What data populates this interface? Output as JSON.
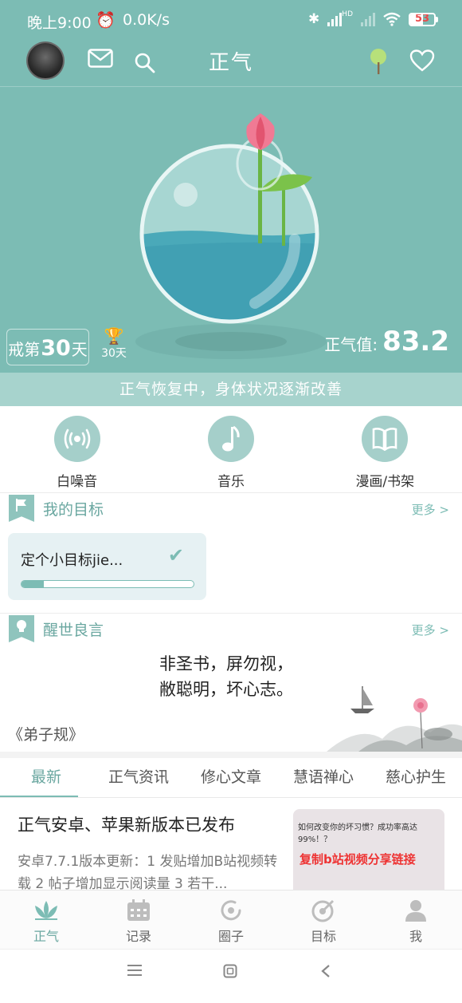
{
  "status": {
    "time": "晚上9:00",
    "speed": "0.0K/s",
    "network": "HD",
    "battery": "53"
  },
  "header": {
    "title": "正气"
  },
  "hero": {
    "streak_prefix": "戒第",
    "streak_days": "30",
    "streak_suffix": "天",
    "trophy_label": "30天",
    "value_label": "正气值:",
    "value": "83.2"
  },
  "banner": "正气恢复中，身体状况逐渐改善",
  "quick_actions": [
    {
      "label": "白噪音",
      "icon": "radio-waves-icon"
    },
    {
      "label": "音乐",
      "icon": "music-note-icon"
    },
    {
      "label": "漫画/书架",
      "icon": "book-icon"
    }
  ],
  "goals": {
    "title": "我的目标",
    "more": "更多 >",
    "card": {
      "name": "定个小目标jie...",
      "progress": 0.13
    }
  },
  "quote": {
    "title": "醒世良言",
    "more": "更多 >",
    "line1": "非圣书，屏勿视，",
    "line2": "敝聪明，坏心志。",
    "source": "《弟子规》"
  },
  "tabs": [
    "最新",
    "正气资讯",
    "修心文章",
    "慧语禅心",
    "慈心护生"
  ],
  "news": {
    "title": "正气安卓、苹果新版本已发布",
    "summary": "安卓7.7.1版本更新：1 发贴增加B站视频转载 2 帖子增加显示阅读量 3 若干...",
    "thumb_text1": "如何改变你的坏习惯？成功率高达99%！？",
    "thumb_text2": "复制b站视频分享链接"
  },
  "tabbar": [
    {
      "label": "正气",
      "icon": "lotus-icon"
    },
    {
      "label": "记录",
      "icon": "calendar-icon"
    },
    {
      "label": "圈子",
      "icon": "circle-refresh-icon"
    },
    {
      "label": "目标",
      "icon": "target-icon"
    },
    {
      "label": "我",
      "icon": "person-icon"
    }
  ],
  "colors": {
    "accent": "#7cbcb4",
    "banner": "#a7d3cd",
    "action_circle": "#a5cfca",
    "goal_card": "#e6f1f3"
  }
}
